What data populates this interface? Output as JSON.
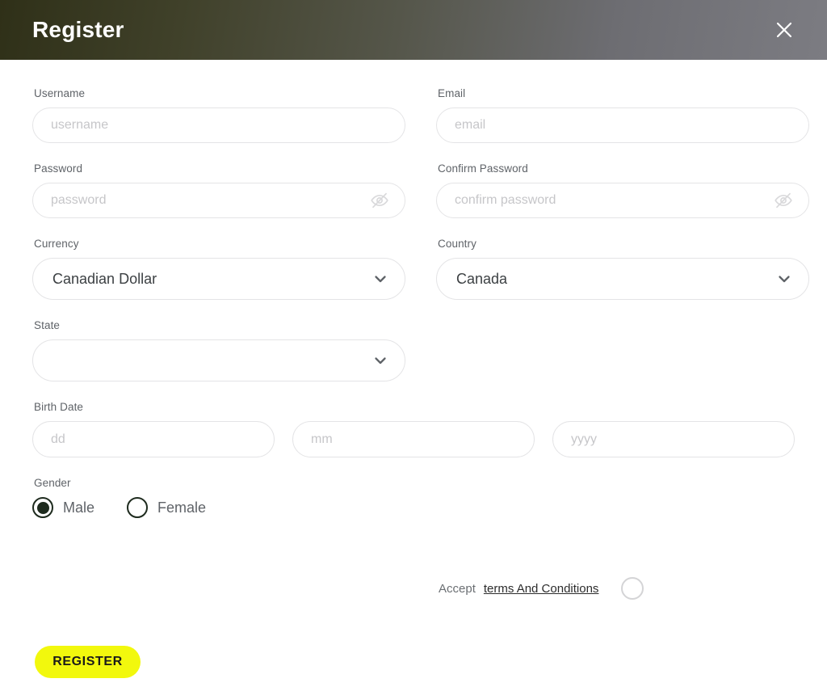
{
  "header": {
    "title": "Register",
    "close_icon": "close-icon",
    "gradient_start": "#2f3018",
    "gradient_end": "#7c7c82",
    "title_color": "#ffffff"
  },
  "form": {
    "username": {
      "label": "Username",
      "placeholder": "username",
      "value": ""
    },
    "email": {
      "label": "Email",
      "placeholder": "email",
      "value": ""
    },
    "password": {
      "label": "Password",
      "placeholder": "password",
      "value": "",
      "toggle_icon": "eye-off-icon"
    },
    "confirm_password": {
      "label": "Confirm Password",
      "placeholder": "confirm password",
      "value": "",
      "toggle_icon": "eye-off-icon"
    },
    "currency": {
      "label": "Currency",
      "value": "Canadian Dollar",
      "options": [
        "Canadian Dollar"
      ],
      "chevron_icon": "chevron-down-icon"
    },
    "country": {
      "label": "Country",
      "value": "Canada",
      "options": [
        "Canada"
      ],
      "chevron_icon": "chevron-down-icon"
    },
    "state": {
      "label": "State",
      "value": "",
      "options": [],
      "chevron_icon": "chevron-down-icon"
    },
    "birth_date": {
      "label": "Birth Date",
      "day": {
        "placeholder": "dd",
        "value": ""
      },
      "month": {
        "placeholder": "mm",
        "value": ""
      },
      "year": {
        "placeholder": "yyyy",
        "value": ""
      }
    },
    "gender": {
      "label": "Gender",
      "selected": "Male",
      "options": [
        {
          "label": "Male",
          "selected": true
        },
        {
          "label": "Female",
          "selected": false
        }
      ],
      "selected_color": "#1e2b1e"
    },
    "accept_terms": {
      "prefix": "Accept",
      "link_text": "terms And Conditions",
      "checked": false
    },
    "submit": {
      "label": "REGISTER",
      "background": "#f2f80d",
      "text_color": "#1a1a1a"
    }
  },
  "colors": {
    "border": "#e4e4e6",
    "placeholder": "#c6c6c9",
    "label": "#5f6368",
    "value_text": "#3c4043"
  }
}
